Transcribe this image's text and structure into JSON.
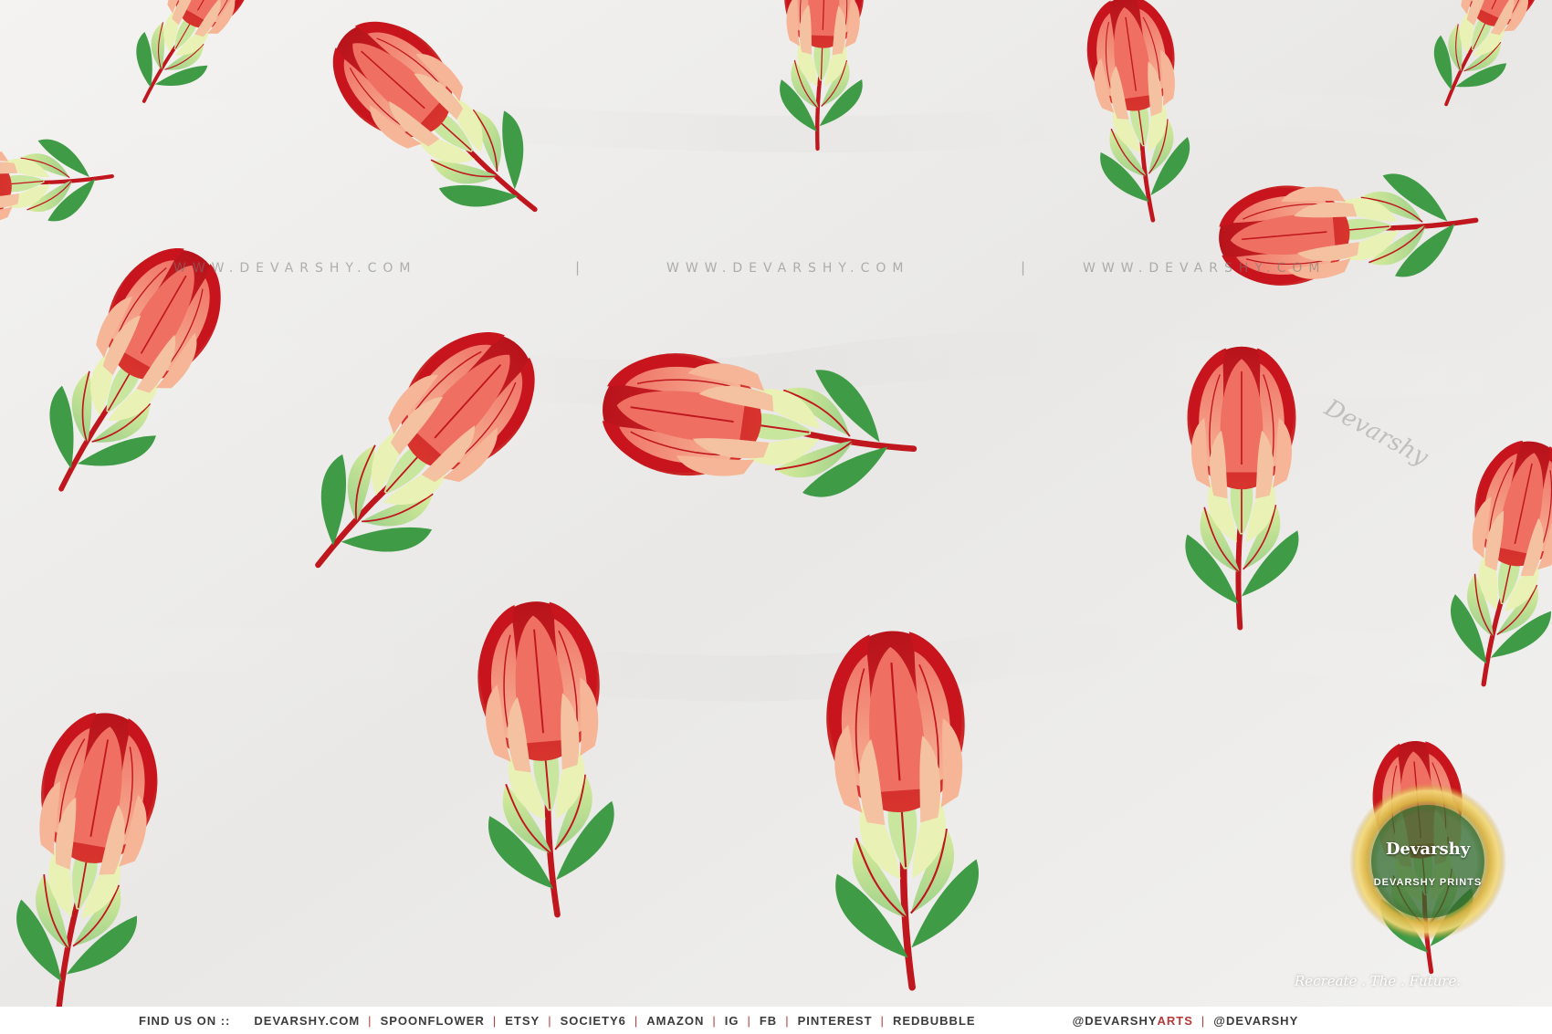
{
  "image": {
    "description_colors": {
      "background": "#efeeec",
      "petal_red": "#c8151d",
      "petal_coral": "#ef6f63",
      "petal_peach": "#f5b093",
      "leaf_green": "#3f9b45",
      "leaf_light": "#cfe596",
      "stem_red": "#c0161d"
    }
  },
  "watermark": {
    "text": "WWW.DEVARSHY.COM",
    "separator": "|"
  },
  "signature": {
    "text": "Devarshy"
  },
  "badge": {
    "name": "Devarshy",
    "sub": "DEVARSHY PRINTS",
    "icon": "logo-icon"
  },
  "tagline": "Recreate . The . Future.",
  "footer": {
    "find_label": "FIND US ON ::",
    "links": [
      "DEVARSHY.COM",
      "SPOONFLOWER",
      "ETSY",
      "SOCIETY6",
      "AMAZON",
      "IG",
      "FB",
      "PINTEREST",
      "REDBUBBLE"
    ],
    "separator": "|",
    "handle_main_prefix": "@DEVARSHY",
    "handle_main_suffix": "ARTS",
    "handle_second": "@DEVARSHY"
  }
}
